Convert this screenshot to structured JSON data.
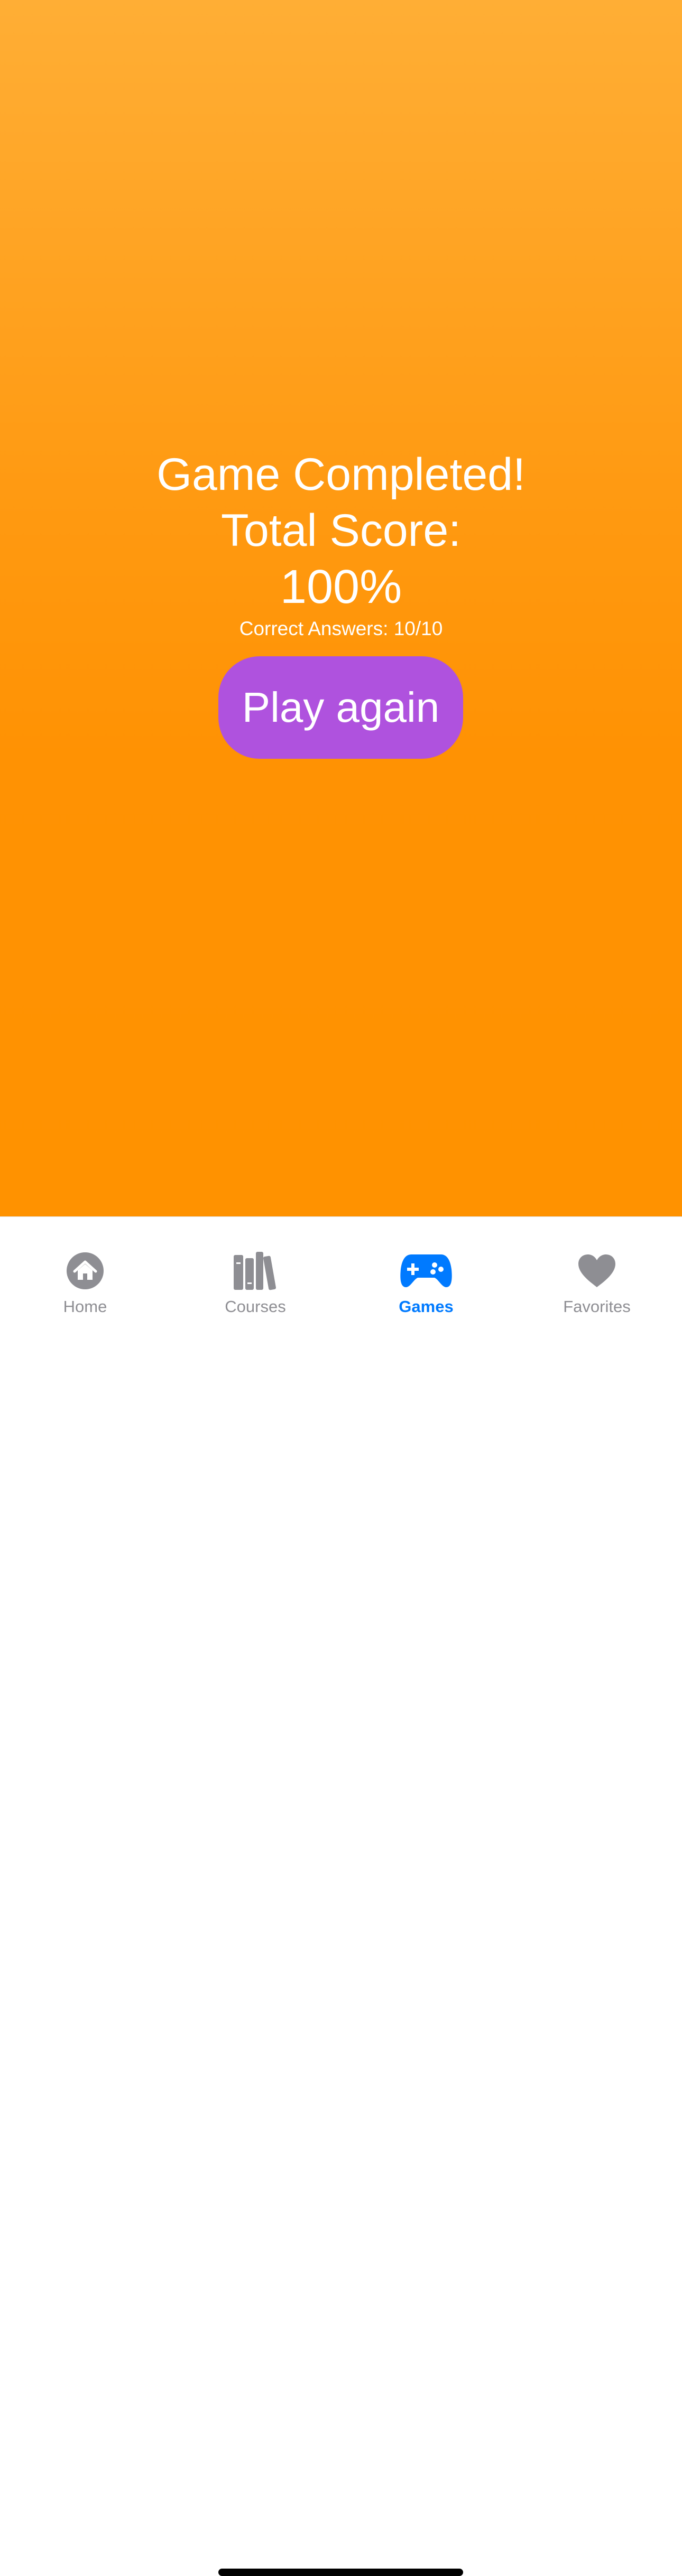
{
  "result": {
    "title": "Game Completed!",
    "score_label": "Total Score:",
    "score_value": "100%",
    "correct_answers": "Correct Answers: 10/10",
    "play_again_label": "Play again"
  },
  "tab_bar": {
    "items": [
      {
        "label": "Home",
        "icon": "house-icon",
        "active": false
      },
      {
        "label": "Courses",
        "icon": "books-icon",
        "active": false
      },
      {
        "label": "Games",
        "icon": "gamecontroller-icon",
        "active": true
      },
      {
        "label": "Favorites",
        "icon": "heart-icon",
        "active": false
      }
    ]
  },
  "colors": {
    "background_top": "#FFAE35",
    "background_bottom": "#FF9200",
    "button": "#AF52DE",
    "active_tab": "#007AFF",
    "inactive_tab": "#8E8E93"
  }
}
